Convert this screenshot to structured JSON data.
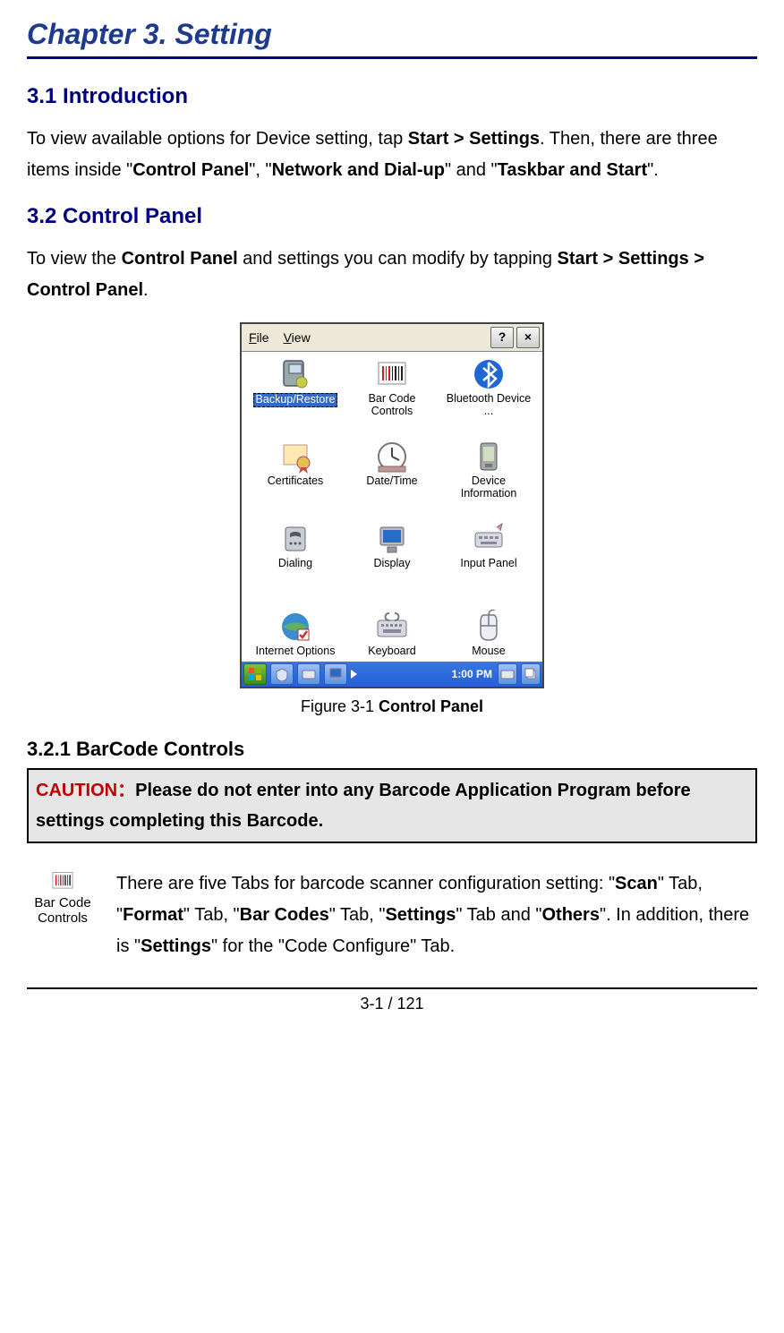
{
  "chapter": {
    "title": "Chapter 3. Setting"
  },
  "sec_intro": {
    "heading": "3.1 Introduction",
    "p1_a": "To view available options for Device setting, tap ",
    "p1_b": "Start > Settings",
    "p1_c": ". Then, there are three items inside \"",
    "p1_d": "Control Panel",
    "p1_e": "\", \"",
    "p1_f": "Network and Dial-up",
    "p1_g": "\" and \"",
    "p1_h": "Taskbar and Start",
    "p1_i": "\"."
  },
  "sec_cp": {
    "heading": "3.2 Control Panel",
    "p1_a": "To view the ",
    "p1_b": "Control Panel",
    "p1_c": " and settings you can modify by tapping ",
    "p1_d": "Start > Settings > Control Panel",
    "p1_e": "."
  },
  "screenshot": {
    "menu_file": "File",
    "menu_view": "View",
    "help_btn": "?",
    "close_btn": "×",
    "items": [
      {
        "label": "Backup/Restore",
        "icon": "backup"
      },
      {
        "label": "Bar Code Controls",
        "icon": "barcode"
      },
      {
        "label": "Bluetooth Device ...",
        "icon": "bluetooth"
      },
      {
        "label": "Certificates",
        "icon": "cert"
      },
      {
        "label": "Date/Time",
        "icon": "clock"
      },
      {
        "label": "Device Information",
        "icon": "pda"
      },
      {
        "label": "Dialing",
        "icon": "phone"
      },
      {
        "label": "Display",
        "icon": "monitor"
      },
      {
        "label": "Input Panel",
        "icon": "input"
      },
      {
        "label": "Internet Options",
        "icon": "globe"
      },
      {
        "label": "Keyboard",
        "icon": "keyboard"
      },
      {
        "label": "Mouse",
        "icon": "mouse"
      }
    ],
    "clock": "1:00 PM"
  },
  "fig_caption": {
    "pre": "Figure 3-1 ",
    "bold": "Control Panel"
  },
  "sec_barcode": {
    "heading": "3.2.1 BarCode Controls",
    "caution_label": "CAUTION：",
    "caution_text": "Please do not enter into any Barcode Application Program before settings completing this Barcode.",
    "mini_label": "Bar Code Controls",
    "p_a": "There are five Tabs for barcode scanner configuration setting: \"",
    "p_b": "Scan",
    "p_c": "\" Tab, \"",
    "p_d": "Format",
    "p_e": "\" Tab, \"",
    "p_f": "Bar Codes",
    "p_g": "\" Tab, \"",
    "p_h": "Settings",
    "p_i": "\" Tab and \"",
    "p_j": "Others",
    "p_k": "\". In addition, there is \"",
    "p_l": "Settings",
    "p_m": "\" for the \"Code Configure\" Tab."
  },
  "page_number": "3-1 / 121"
}
